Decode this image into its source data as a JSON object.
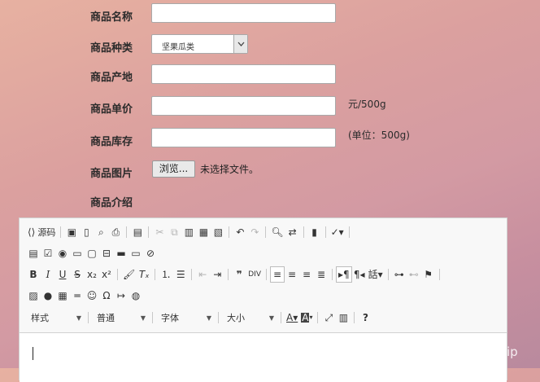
{
  "form": {
    "name": {
      "label": "商品名称",
      "value": ""
    },
    "category": {
      "label": "商品种类",
      "selected": "坚果瓜类"
    },
    "origin": {
      "label": "商品产地",
      "value": ""
    },
    "price": {
      "label": "商品单价",
      "value": "",
      "unit": "元/500g"
    },
    "stock": {
      "label": "商品库存",
      "value": "",
      "unit": "(单位：500g)"
    },
    "image": {
      "label": "商品图片",
      "button": "浏览...",
      "status": "未选择文件。"
    },
    "intro": {
      "label": "商品介绍"
    }
  },
  "editor": {
    "source_label": "源码",
    "combos": {
      "styles": "样式",
      "format": "普通",
      "font": "字体",
      "size": "大小"
    }
  },
  "watermark": "CSDN @biyezuopinvip"
}
